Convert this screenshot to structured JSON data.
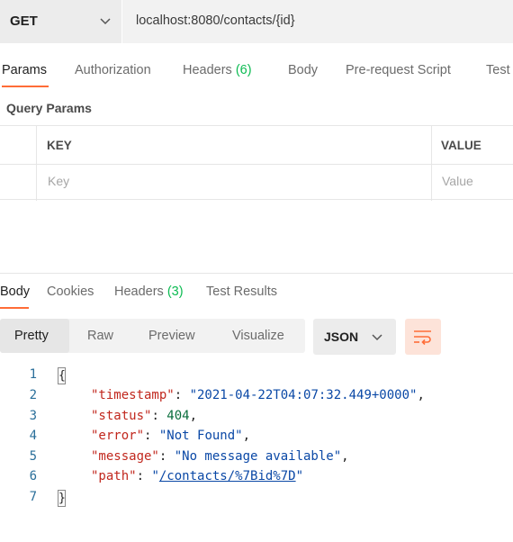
{
  "request": {
    "method": "GET",
    "url": "localhost:8080/contacts/{id}"
  },
  "request_tabs": {
    "params": "Params",
    "authorization": "Authorization",
    "headers": "Headers",
    "headers_count": "(6)",
    "body": "Body",
    "pre_request_script": "Pre-request Script",
    "tests": "Test"
  },
  "query_params": {
    "title": "Query Params",
    "key_header": "KEY",
    "value_header": "VALUE",
    "key_placeholder": "Key",
    "value_placeholder": "Value"
  },
  "response_tabs": {
    "body": "Body",
    "cookies": "Cookies",
    "headers": "Headers",
    "headers_count": "(3)",
    "test_results": "Test Results"
  },
  "view_modes": {
    "pretty": "Pretty",
    "raw": "Raw",
    "preview": "Preview",
    "visualize": "Visualize"
  },
  "format": "JSON",
  "response_body": {
    "line_numbers": [
      "1",
      "2",
      "3",
      "4",
      "5",
      "6",
      "7"
    ],
    "open_brace": "{",
    "close_brace": "}",
    "timestamp_key": "\"timestamp\"",
    "timestamp_value": "\"2021-04-22T04:07:32.449+0000\"",
    "status_key": "\"status\"",
    "status_value": "404",
    "error_key": "\"error\"",
    "error_value": "\"Not Found\"",
    "message_key": "\"message\"",
    "message_value": "\"No message available\"",
    "path_key": "\"path\"",
    "path_value": "/contacts/%7Bid%7D",
    "colon": ": ",
    "comma": ",",
    "quote": "\""
  },
  "colors": {
    "accent": "#ff6c37",
    "count_green": "#0cbb52",
    "json_key": "#c1271d",
    "json_string": "#0a48a6",
    "json_number": "#0a6e3c"
  }
}
